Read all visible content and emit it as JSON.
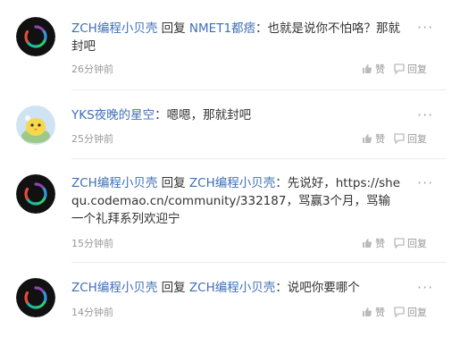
{
  "comments": [
    {
      "avatar": "zch-ring",
      "author": "ZCH编程小贝壳",
      "reply_word": "回复",
      "reply_to": "NMET1都痞",
      "text": "：也就是说你不怕咯？那就封吧",
      "time": "26分钟前",
      "like_label": "赞",
      "reply_label": "回复"
    },
    {
      "avatar": "yks-chick",
      "author": "YKS夜晚的星空",
      "reply_word": "",
      "reply_to": "",
      "text": "：嗯嗯，那就封吧",
      "time": "25分钟前",
      "like_label": "赞",
      "reply_label": "回复"
    },
    {
      "avatar": "zch-ring",
      "author": "ZCH编程小贝壳",
      "reply_word": "回复",
      "reply_to": "ZCH编程小贝壳",
      "text": "：先说好，https://shequ.codemao.cn/community/332187，骂赢3个月，骂输一个礼拜系列欢迎宁",
      "time": "15分钟前",
      "like_label": "赞",
      "reply_label": "回复"
    },
    {
      "avatar": "zch-ring",
      "author": "ZCH编程小贝壳",
      "reply_word": "回复",
      "reply_to": "ZCH编程小贝壳",
      "text": "：说吧你要哪个",
      "time": "14分钟前",
      "like_label": "赞",
      "reply_label": "回复"
    }
  ],
  "more_glyph": "···",
  "colors": {
    "name": "#3f6fb6",
    "meta": "#999999",
    "separator": "#ececec"
  }
}
